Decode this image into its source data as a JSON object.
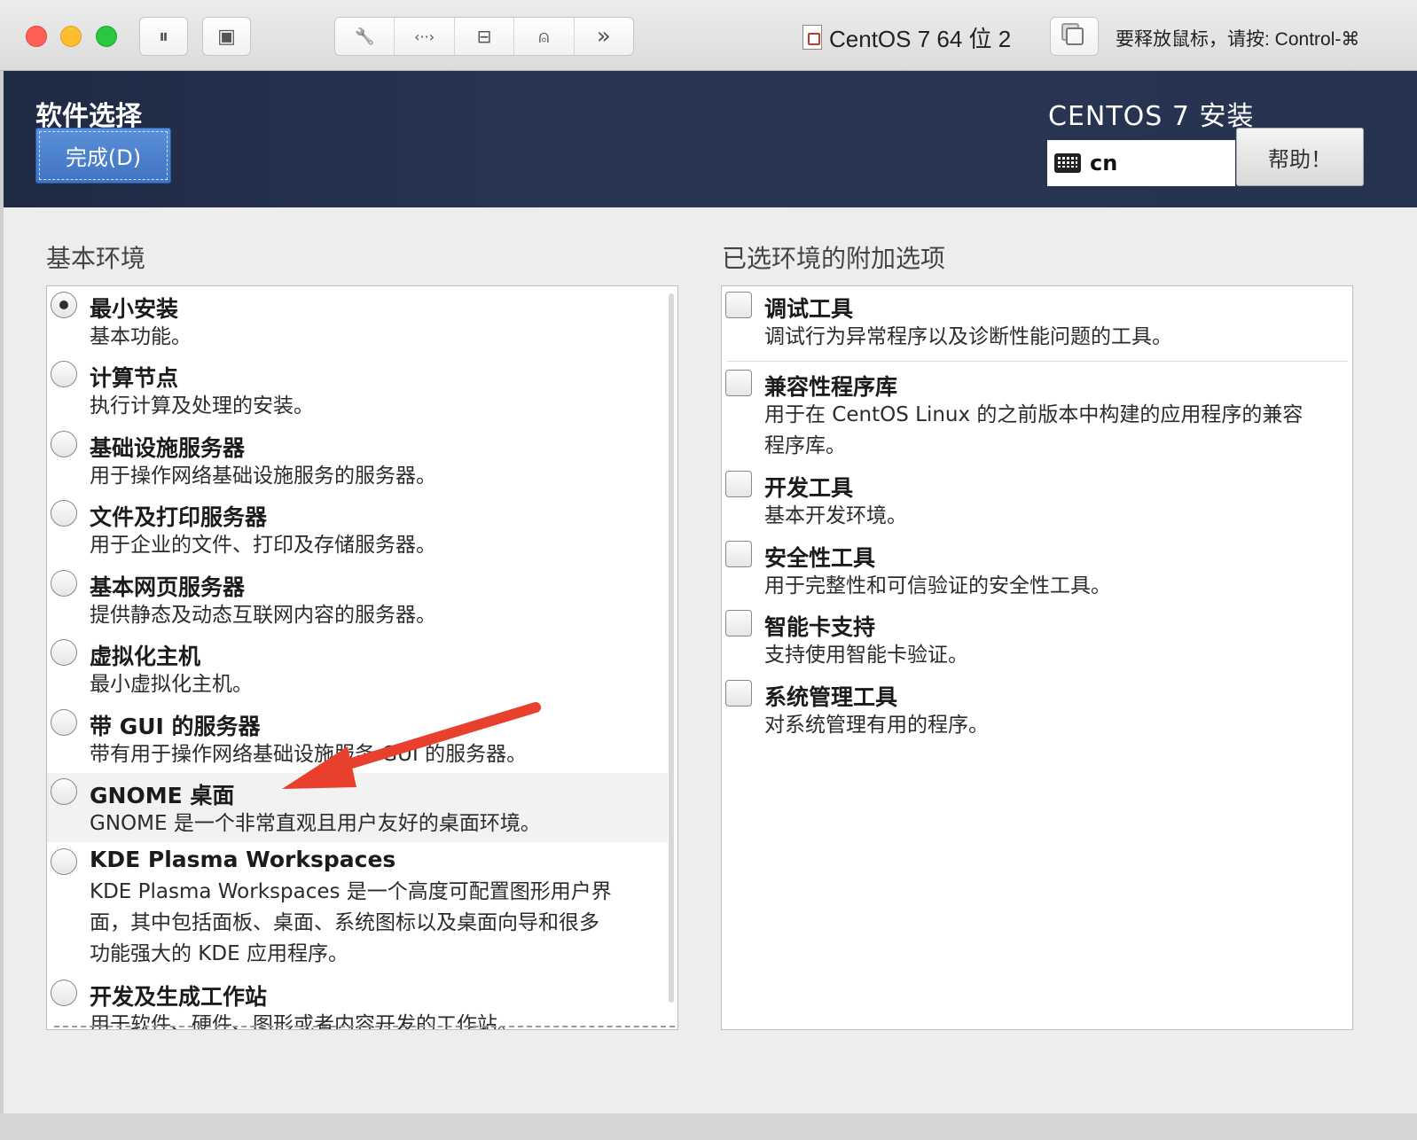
{
  "toolbar": {
    "pause_icon": "pause-icon",
    "snapshot_icon": "snapshot-icon",
    "settings_icon": "wrench-icon",
    "network_icon": "code-arrows-icon",
    "disk_icon": "disk-icon",
    "user_icon": "user-share-icon",
    "more_icon": "chevron-double-right-icon",
    "pause_glyph": "⏸",
    "snapshot_glyph": "▣",
    "settings_glyph": "🔧",
    "network_glyph": "‹··›",
    "disk_glyph": "⊟",
    "user_glyph": "⍝",
    "more_glyph": "»"
  },
  "window": {
    "title": "CentOS 7 64 位 2",
    "release_hint": "要释放鼠标，请按: Control-⌘"
  },
  "header": {
    "page_title": "软件选择",
    "done_label": "完成(D)",
    "product_title": "CENTOS 7 安装",
    "keyboard_layout": "cn",
    "help_label": "帮助！"
  },
  "base_env": {
    "title": "基本环境",
    "items": [
      {
        "title": "最小安装",
        "desc": "基本功能。",
        "selected": true
      },
      {
        "title": "计算节点",
        "desc": "执行计算及处理的安装。",
        "selected": false
      },
      {
        "title": "基础设施服务器",
        "desc": "用于操作网络基础设施服务的服务器。",
        "selected": false
      },
      {
        "title": "文件及打印服务器",
        "desc": "用于企业的文件、打印及存储服务器。",
        "selected": false
      },
      {
        "title": "基本网页服务器",
        "desc": "提供静态及动态互联网内容的服务器。",
        "selected": false
      },
      {
        "title": "虚拟化主机",
        "desc": "最小虚拟化主机。",
        "selected": false
      },
      {
        "title": "带 GUI 的服务器",
        "desc": "带有用于操作网络基础设施服务 GUI 的服务器。",
        "selected": false
      },
      {
        "title": "GNOME 桌面",
        "desc": "GNOME 是一个非常直观且用户友好的桌面环境。",
        "selected": false
      },
      {
        "title": "KDE Plasma Workspaces",
        "desc_lines": [
          "KDE Plasma Workspaces 是一个高度可配置图形用户界",
          "面，其中包括面板、桌面、系统图标以及桌面向导和很多",
          "功能强大的 KDE 应用程序。"
        ],
        "selected": false
      },
      {
        "title": "开发及生成工作站",
        "desc": "用于软件、硬件、图形或者内容开发的工作站。",
        "selected": false
      }
    ]
  },
  "addons": {
    "title": "已选环境的附加选项",
    "items": [
      {
        "title": "调试工具",
        "desc": "调试行为异常程序以及诊断性能问题的工具。",
        "checked": false
      },
      {
        "title": "兼容性程序库",
        "desc_lines": [
          "用于在 CentOS Linux 的之前版本中构建的应用程序的兼容",
          "程序库。"
        ],
        "checked": false
      },
      {
        "title": "开发工具",
        "desc": "基本开发环境。",
        "checked": false
      },
      {
        "title": "安全性工具",
        "desc": "用于完整性和可信验证的安全性工具。",
        "checked": false
      },
      {
        "title": "智能卡支持",
        "desc": "支持使用智能卡验证。",
        "checked": false
      },
      {
        "title": "系统管理工具",
        "desc": "对系统管理有用的程序。",
        "checked": false
      }
    ]
  },
  "colors": {
    "header_bg": "#263350",
    "done_button": "#4a80cc",
    "annotation_arrow": "#e8402d"
  }
}
